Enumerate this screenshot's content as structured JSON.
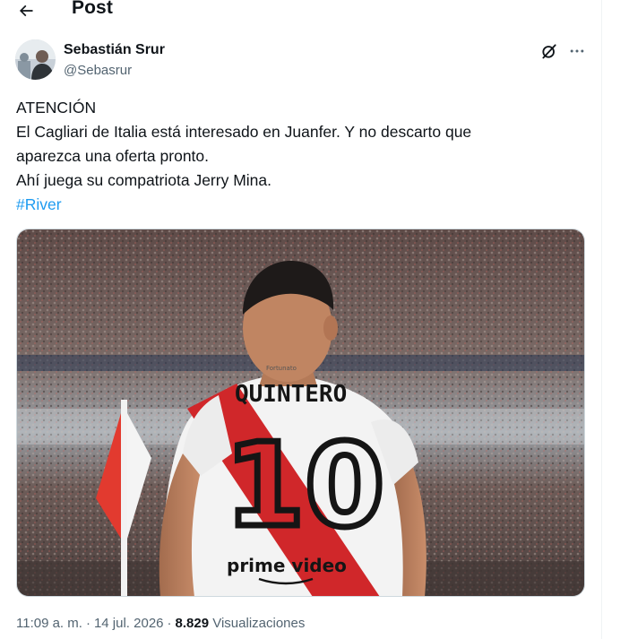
{
  "header": {
    "title": "Post",
    "back_icon": "arrow-left-icon"
  },
  "author": {
    "name": "Sebastián Srur",
    "handle": "@Sebasrur"
  },
  "tweet": {
    "lines": [
      "ATENCIÓN",
      "El Cagliari de Italia está interesado en Juanfer. Y no descarto que",
      "aparezca una oferta pronto.",
      "Ahí juega su compatriota Jerry Mina."
    ],
    "hashtag": "#River"
  },
  "media": {
    "jersey_name": "QUINTERO",
    "jersey_number": "10",
    "sponsor": "prime video",
    "sleeve_brand": "Fortunato",
    "colors": {
      "jersey": "#f3f3f3",
      "sash": "#d0272a",
      "crowd": "#6b5a55"
    }
  },
  "meta": {
    "time": "11:09 a. m.",
    "separator": "·",
    "date": "14 jul. 2026",
    "views_count": "8.829",
    "views_label": "Visualizaciones"
  },
  "icons": {
    "grok": "grok-icon",
    "more": "more-dots-icon"
  }
}
